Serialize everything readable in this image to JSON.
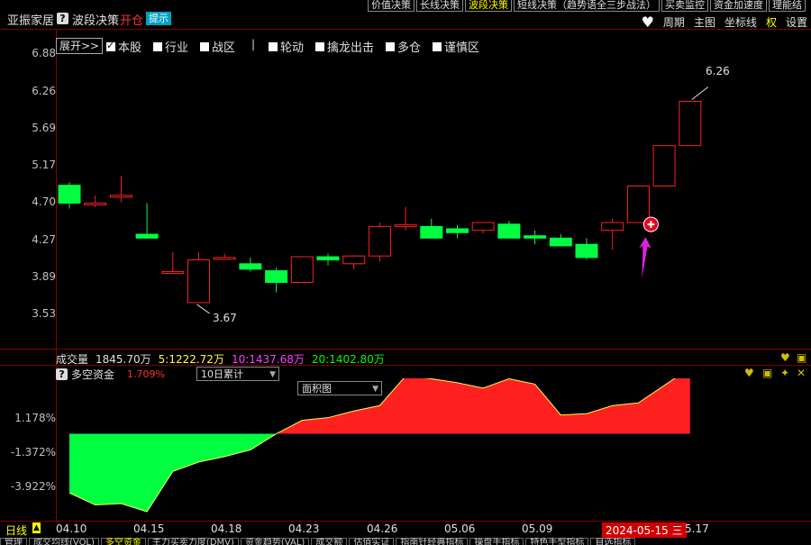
{
  "header": {
    "stock_name": "亚振家居",
    "help_icon": "?",
    "strategy_title": "波段决策",
    "open_label": "开仓",
    "hint_label": "提示"
  },
  "top_tabs": [
    {
      "label": "价值决策",
      "active": false
    },
    {
      "label": "长线决策",
      "active": false
    },
    {
      "label": "波段决策",
      "active": true
    },
    {
      "label": "短线决策（趋势语全三步战法）",
      "active": false
    },
    {
      "label": "买卖监控",
      "active": false
    },
    {
      "label": "资金加速度",
      "active": false
    },
    {
      "label": "理能结",
      "active": false
    }
  ],
  "right_menu": [
    "周期",
    "主图",
    "坐标线",
    "权",
    "设置"
  ],
  "checkbox_row": {
    "expand_label": "展开>>",
    "separator": "|",
    "items": [
      {
        "label": "本股",
        "checked": true
      },
      {
        "label": "行业",
        "checked": false
      },
      {
        "label": "战区",
        "checked": false
      },
      {
        "label": "轮动",
        "checked": false
      },
      {
        "label": "擒龙出击",
        "checked": false
      },
      {
        "label": "多仓",
        "checked": false
      },
      {
        "label": "谨慎区",
        "checked": false
      }
    ]
  },
  "price_axis": [
    "6.88",
    "6.26",
    "5.69",
    "5.17",
    "4.70",
    "4.27",
    "3.89",
    "3.53"
  ],
  "annotations": {
    "high": "6.26",
    "low": "3.67"
  },
  "volume": {
    "label": "成交量",
    "value": "1845.70万",
    "ma5": "5:1222.72万",
    "ma10": "10:1437.68万",
    "ma20": "20:1402.80万"
  },
  "indicator": {
    "help_icon": "?",
    "name": "多空资金",
    "value": "1.709%",
    "period_select": "10日累计",
    "style_select": "面积图",
    "axis": [
      "1.178%",
      "-1.372%",
      "-3.922%"
    ]
  },
  "date_axis": {
    "period_label": "日线",
    "dates": [
      "04.10",
      "04.15",
      "04.18",
      "04.23",
      "04.26",
      "05.06",
      "05.09",
      "5.17"
    ],
    "current_date": "2024-05-15",
    "current_weekday": "三"
  },
  "bottom_tabs": [
    {
      "label": "管理",
      "active": false
    },
    {
      "label": "成交均线(VOL)",
      "active": false
    },
    {
      "label": "多空资金",
      "active": true
    },
    {
      "label": "主力买卖力度(DMV)",
      "active": false
    },
    {
      "label": "资金趋势(VAL)",
      "active": false
    },
    {
      "label": "成交额",
      "active": false
    },
    {
      "label": "估值实证",
      "active": false
    },
    {
      "label": "指南针经典指标",
      "active": false
    },
    {
      "label": "操盘手指标",
      "active": false
    },
    {
      "label": "特色手型指标",
      "active": false
    },
    {
      "label": "自选指标",
      "active": false
    }
  ],
  "colors": {
    "up": "#ff2020",
    "down": "#00ff40",
    "axis": "#c0c0c0",
    "hint_bg": "#00a0c0",
    "arrow": "#e020e0",
    "ma10": "#ff40ff",
    "ma20": "#00ff00",
    "ma5": "#ffff40"
  },
  "chart_data": [
    {
      "type": "candlestick",
      "x": [
        "04.10",
        "04.11",
        "04.12",
        "04.15",
        "04.16",
        "04.17",
        "04.18",
        "04.19",
        "04.22",
        "04.23",
        "04.24",
        "04.25",
        "04.26",
        "04.29",
        "04.30",
        "05.06",
        "05.07",
        "05.08",
        "05.09",
        "05.10",
        "05.13",
        "05.14",
        "05.15",
        "05.16",
        "05.17"
      ],
      "open": [
        5.18,
        4.95,
        5.05,
        4.55,
        4.07,
        3.67,
        4.25,
        4.17,
        4.08,
        3.93,
        4.26,
        4.17,
        4.27,
        4.65,
        4.65,
        4.62,
        4.6,
        4.68,
        4.53,
        4.5,
        4.42,
        4.6,
        4.7,
        5.17,
        5.69
      ],
      "high": [
        5.22,
        5.05,
        5.3,
        4.95,
        4.32,
        4.32,
        4.3,
        4.25,
        4.12,
        4.27,
        4.3,
        4.28,
        4.7,
        4.9,
        4.75,
        4.67,
        4.7,
        4.72,
        4.6,
        4.55,
        4.5,
        4.75,
        5.17,
        5.69,
        6.26
      ],
      "low": [
        4.88,
        4.9,
        4.96,
        4.53,
        4.07,
        3.67,
        4.22,
        4.07,
        3.8,
        3.93,
        4.15,
        4.1,
        4.2,
        4.6,
        4.5,
        4.5,
        4.56,
        4.56,
        4.42,
        4.4,
        4.22,
        4.35,
        4.7,
        5.4,
        5.69
      ],
      "close": [
        4.95,
        4.95,
        5.05,
        4.5,
        4.07,
        4.22,
        4.25,
        4.1,
        3.93,
        4.26,
        4.22,
        4.27,
        4.65,
        4.67,
        4.5,
        4.57,
        4.7,
        4.5,
        4.5,
        4.4,
        4.25,
        4.7,
        5.17,
        5.69,
        6.26
      ],
      "ylim": [
        3.4,
        7.0
      ],
      "yticks": [
        6.88,
        6.26,
        5.69,
        5.17,
        4.7,
        4.27,
        3.89,
        3.53
      ],
      "annotations": [
        {
          "label": "6.26",
          "value": 6.26
        },
        {
          "label": "3.67",
          "value": 3.67
        }
      ],
      "buy_signal_index": 22
    },
    {
      "type": "area",
      "x": [
        "04.10",
        "04.11",
        "04.12",
        "04.15",
        "04.16",
        "04.17",
        "04.18",
        "04.19",
        "04.22",
        "04.23",
        "04.24",
        "04.25",
        "04.26",
        "04.29",
        "04.30",
        "05.06",
        "05.07",
        "05.08",
        "05.09",
        "05.10",
        "05.13",
        "05.14",
        "05.15",
        "05.16",
        "05.17"
      ],
      "values": [
        -4.4,
        -5.3,
        -5.2,
        -5.8,
        -2.8,
        -2.1,
        -1.7,
        -1.2,
        0.0,
        1.0,
        1.2,
        1.7,
        2.1,
        4.3,
        4.1,
        3.8,
        3.4,
        4.1,
        3.7,
        1.4,
        1.5,
        2.1,
        2.3,
        3.6,
        4.9
      ],
      "yticks": [
        1.178,
        -1.372,
        -3.922
      ],
      "ylim": [
        -6.2,
        5.2
      ]
    }
  ]
}
